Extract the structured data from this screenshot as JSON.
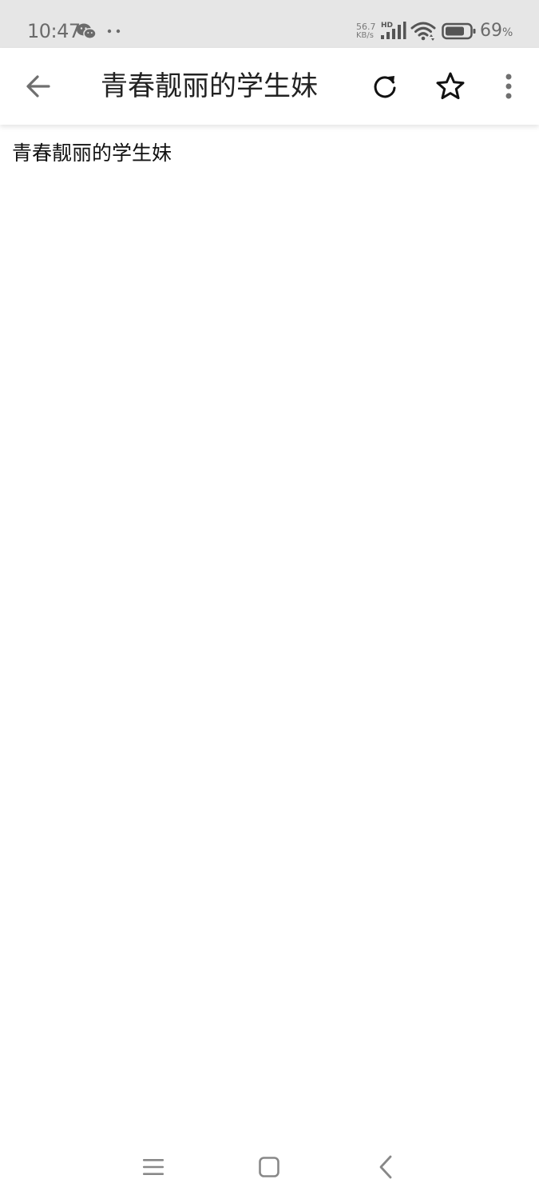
{
  "status_bar": {
    "time": "10:47",
    "net_speed_value": "56.7",
    "net_speed_unit": "KB/s",
    "network_type": "HD",
    "battery_level": "69",
    "battery_unit": "%",
    "icons": [
      "wechat-icon",
      "more-notifications-dots-icon",
      "signal-icon",
      "wifi-icon",
      "battery-icon"
    ]
  },
  "app_bar": {
    "title": "青春靓丽的学生妹",
    "icons": [
      "back-arrow-icon",
      "refresh-icon",
      "star-icon",
      "more-vert-icon"
    ]
  },
  "content": {
    "text": "青春靓丽的学生妹"
  },
  "nav_bar": {
    "icons": [
      "menu-icon",
      "home-square-icon",
      "back-chevron-icon"
    ]
  },
  "colors": {
    "status_bar_bg": "#e6e6e6",
    "status_text": "#6b6b6b",
    "app_bar_bg": "#ffffff",
    "title_text": "#222222",
    "icon_dark": "#111111",
    "icon_gray": "#6f6f6f",
    "nav_icon": "#888888"
  }
}
